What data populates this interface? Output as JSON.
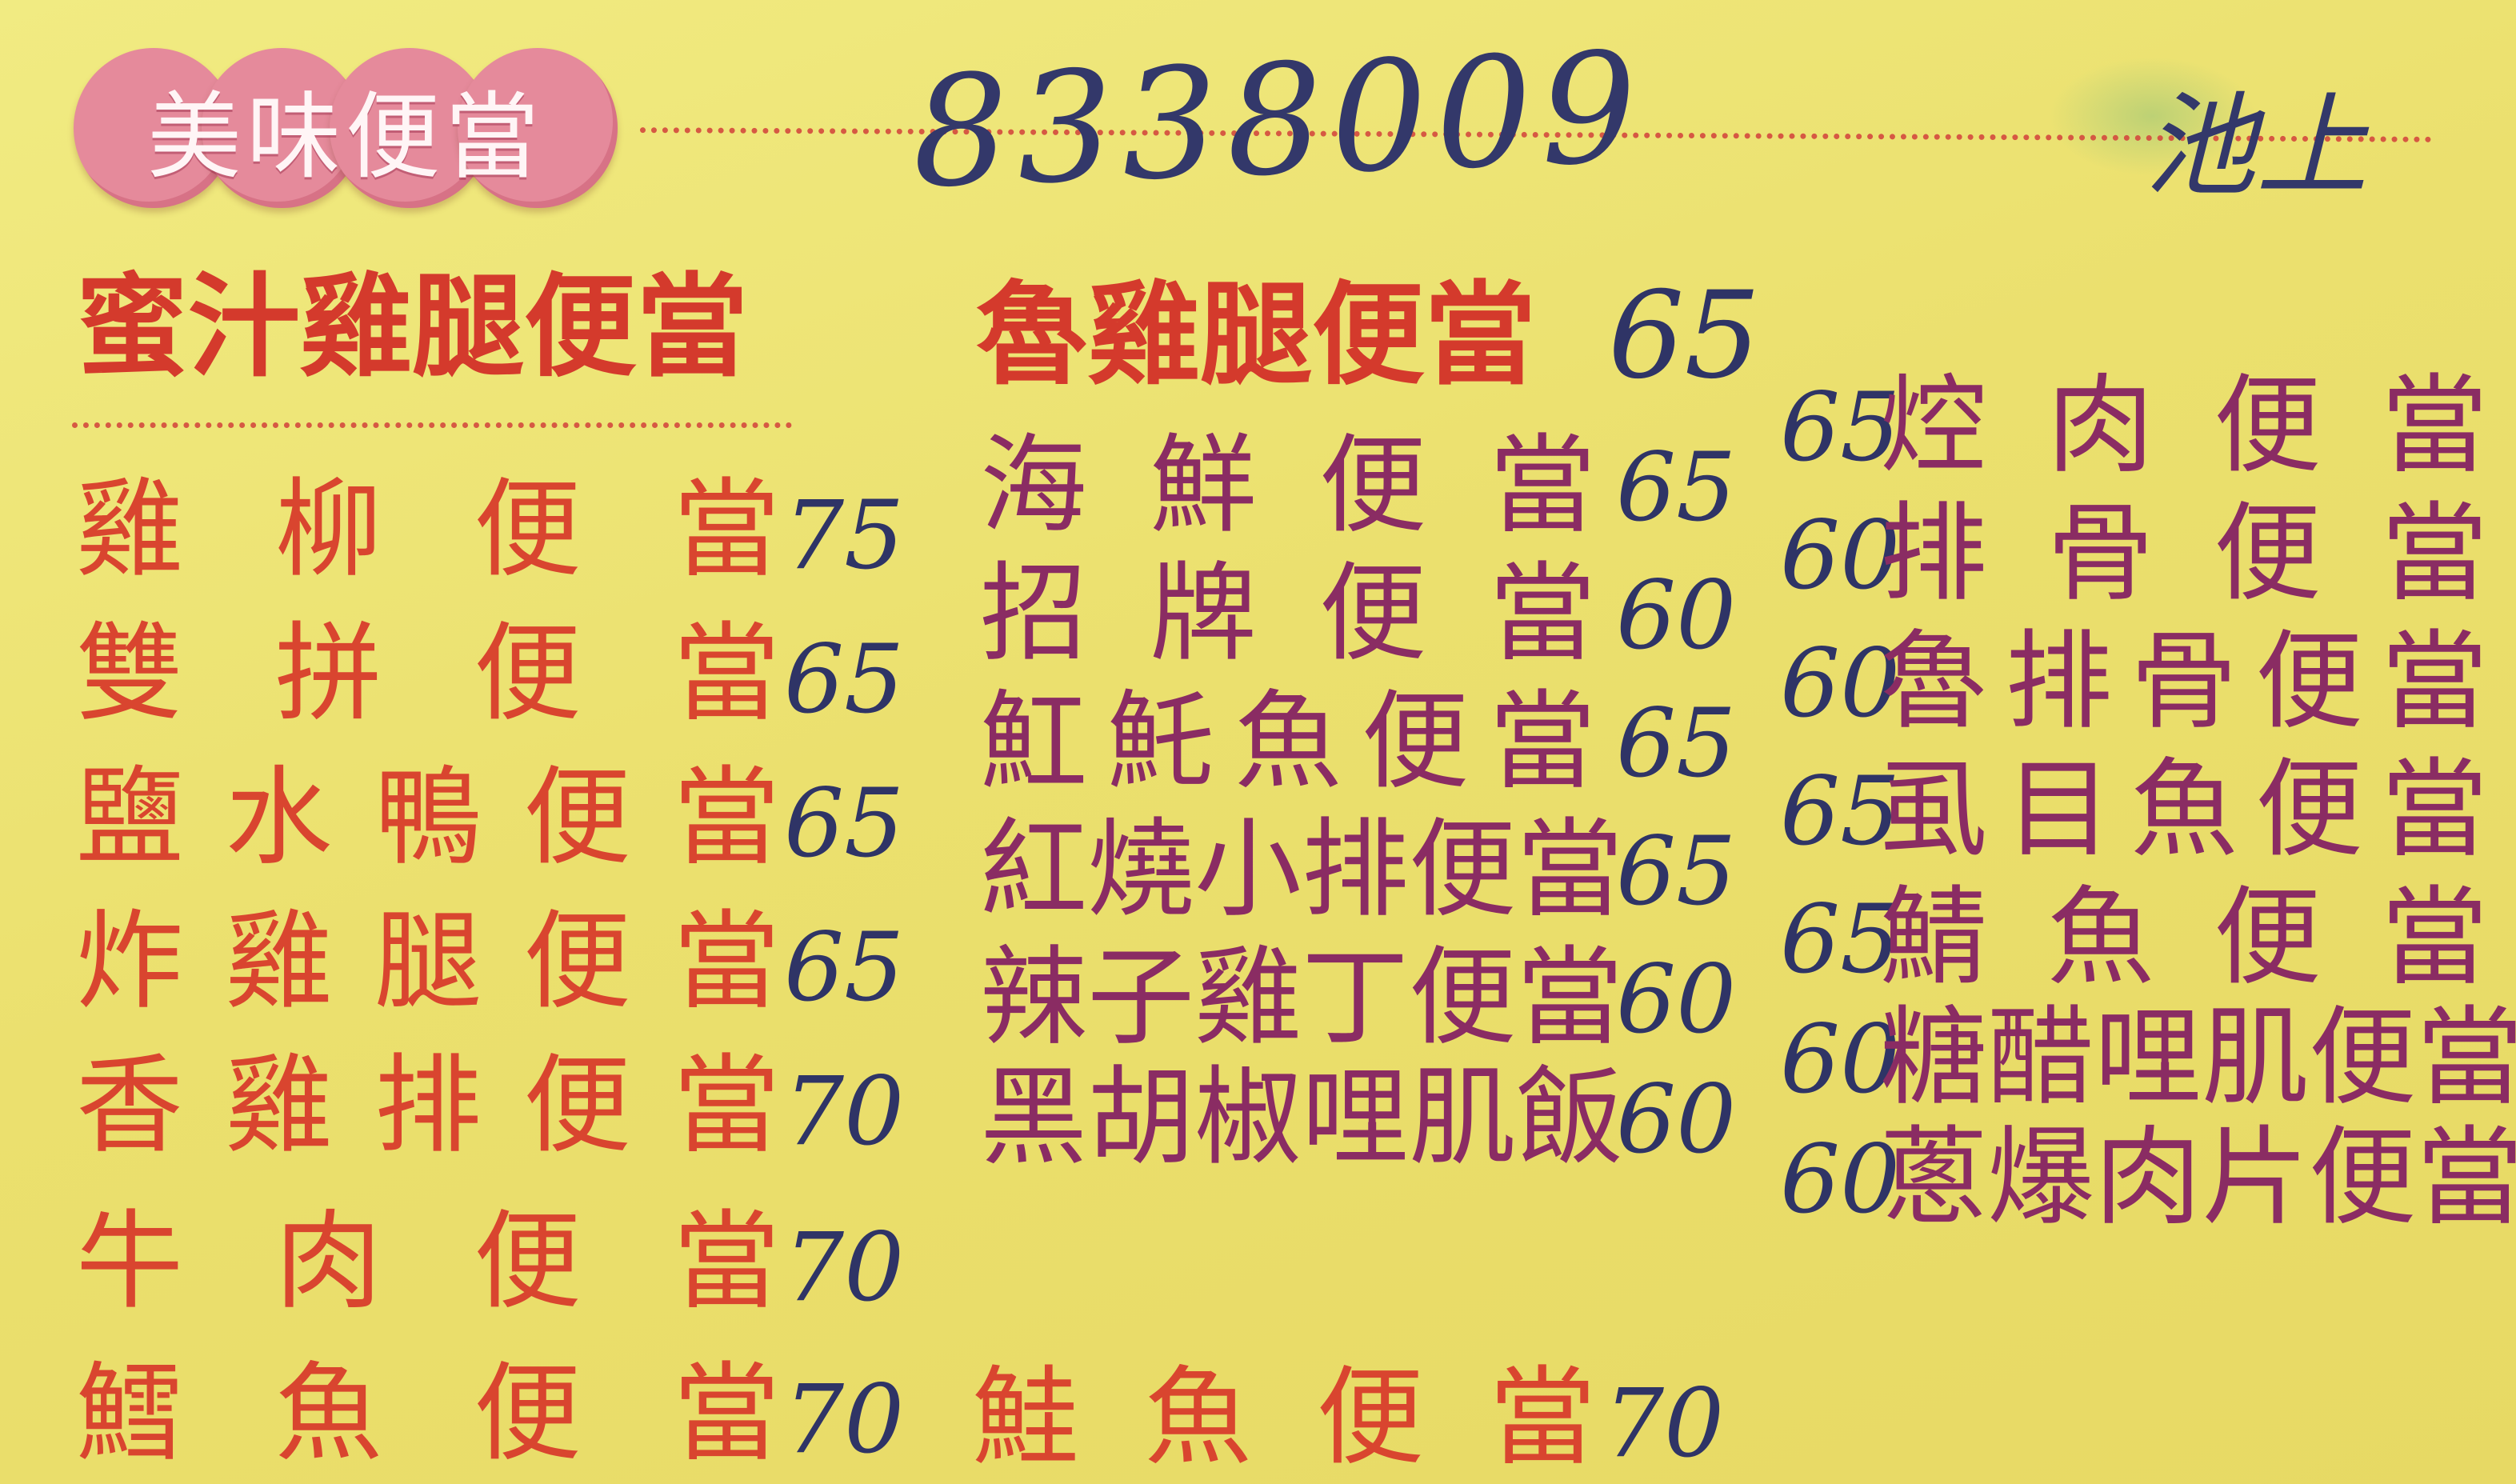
{
  "logo": {
    "text": "美味便當"
  },
  "handwritten": {
    "phone": "8338009",
    "place": "池上"
  },
  "headings": {
    "left": "蜜汁雞腿便當",
    "middle": "魯雞腿便當",
    "middle_price": "65"
  },
  "column1": [
    {
      "name": "雞柳便當",
      "price": "75"
    },
    {
      "name": "雙拼便當",
      "price": "65"
    },
    {
      "name": "鹽水鴨便當",
      "price": "65"
    },
    {
      "name": "炸雞腿便當",
      "price": "65"
    },
    {
      "name": "香雞排便當",
      "price": "70"
    },
    {
      "name": "牛肉便當",
      "price": "70"
    },
    {
      "name": "鱈魚便當",
      "price": "70"
    }
  ],
  "column2": [
    {
      "name": "海鮮便當",
      "price": "65"
    },
    {
      "name": "招牌便當",
      "price": "60"
    },
    {
      "name": "魟魠魚便當",
      "price": "65"
    },
    {
      "name": "紅燒小排便當",
      "price": "65"
    },
    {
      "name": "辣子雞丁便當",
      "price": "60"
    },
    {
      "name": "黑胡椒哩肌飯",
      "price": "60"
    }
  ],
  "bottom_middle": {
    "name": "鮭魚便當",
    "price": "70"
  },
  "column3": [
    {
      "name": "焢肉便當",
      "price": "65"
    },
    {
      "name": "排骨便當",
      "price": "60"
    },
    {
      "name": "魯排骨便當",
      "price": "60"
    },
    {
      "name": "虱目魚便當",
      "price": "65"
    },
    {
      "name": "鯖魚便當",
      "price": "65"
    },
    {
      "name": "糖醋哩肌便當",
      "price": "60"
    },
    {
      "name": "蔥爆肉片便當",
      "price": "60"
    }
  ]
}
